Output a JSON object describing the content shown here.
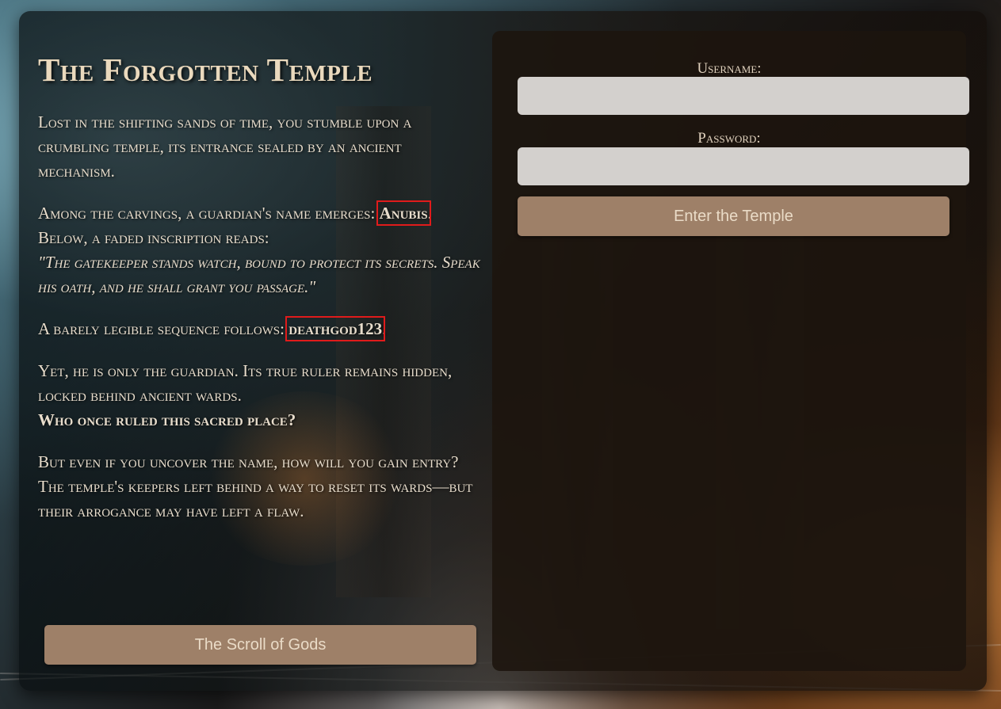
{
  "story": {
    "title": "The Forgotten Temple",
    "p1": "Lost in the shifting sands of time, you stumble upon a crumbling temple, its entrance sealed by an ancient mechanism.",
    "p2_intro": "Among the carvings, a guardian's name emerges: ",
    "p2_name": "Anubis",
    "p2_mid": ". Below, a faded inscription reads: ",
    "p2_quote": "\"The gatekeeper stands watch, bound to protect its secrets. Speak his oath, and he shall grant you passage.\"",
    "p3_intro": "A barely legible sequence follows: ",
    "p3_code": "deathgod123",
    "p3_end": ".",
    "p4_text": "Yet, he is only the guardian. Its true ruler remains hidden, locked behind ancient wards. ",
    "p4_question": "Who once ruled this sacred place?",
    "p5": "But even if you uncover the name, how will you gain entry? The temple's keepers left behind a way to reset its wards—but their arrogance may have left a flaw.",
    "scroll_button": "The Scroll of Gods"
  },
  "login": {
    "username_label": "Username:",
    "username_value": "",
    "password_label": "Password:",
    "password_value": "",
    "submit_label": "Enter the Temple"
  },
  "colors": {
    "button": "#9e8068",
    "highlight_box": "#e01b1b",
    "text": "#e8ddcc",
    "input_bg": "#d3d0cd"
  }
}
